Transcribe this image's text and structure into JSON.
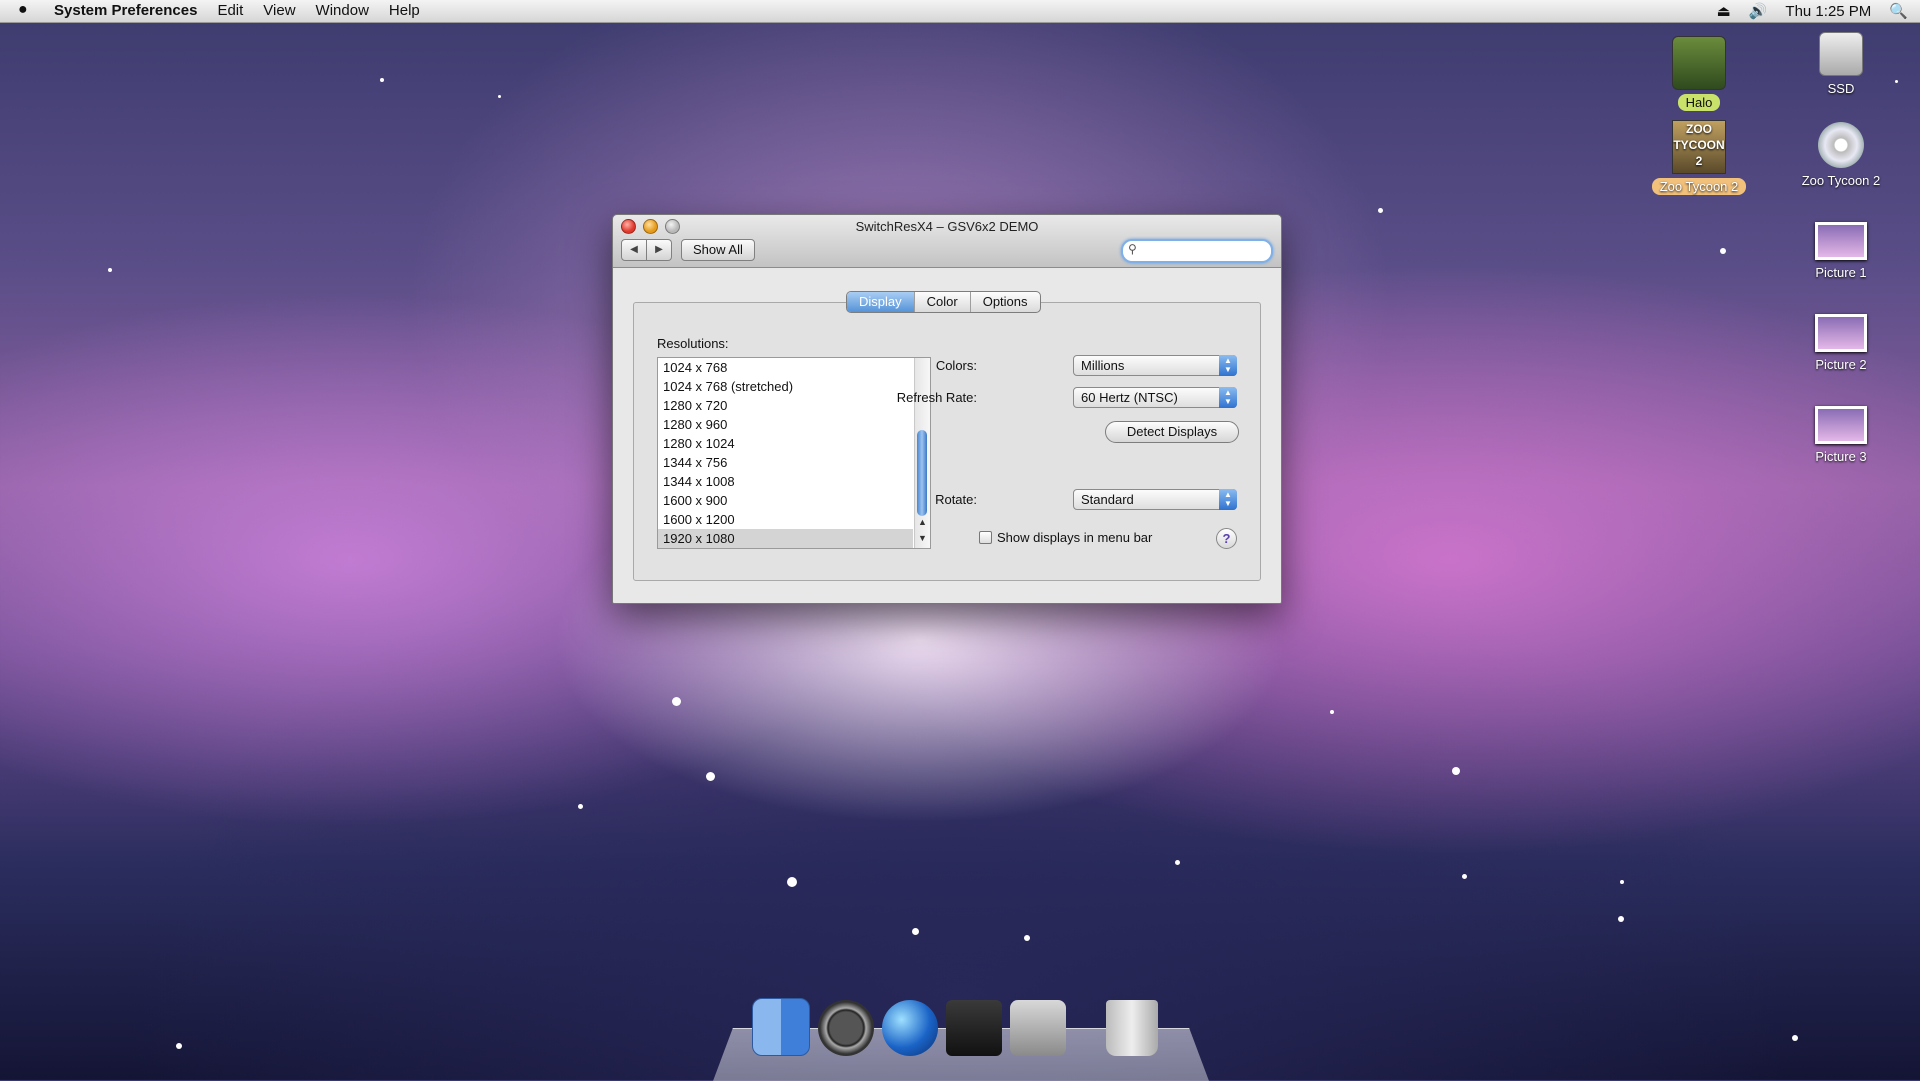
{
  "menubar": {
    "apple": "",
    "app_name": "System Preferences",
    "menus": [
      "Edit",
      "View",
      "Window",
      "Help"
    ],
    "clock": "Thu 1:25 PM"
  },
  "desktop": {
    "icons": [
      {
        "label": "Halo",
        "icon": "game-icon"
      },
      {
        "label": "SSD",
        "icon": "hard-drive-icon"
      },
      {
        "label": "Zoo Tycoon 2",
        "icon": "game-icon"
      },
      {
        "label": "Zoo Tycoon 2",
        "icon": "cd-icon"
      },
      {
        "label": "Picture 1",
        "icon": "picture-icon"
      },
      {
        "label": "Picture 2",
        "icon": "picture-icon"
      },
      {
        "label": "Picture 3",
        "icon": "picture-icon"
      }
    ],
    "zoo_box_text": "ZOO TYCOON 2"
  },
  "window": {
    "title": "SwitchResX4 – GSV6x2 DEMO",
    "show_all": "Show All",
    "search": {
      "value": "",
      "placeholder": ""
    },
    "tabs": [
      "Display",
      "Color",
      "Options"
    ],
    "active_tab": "Display",
    "resolutions_label": "Resolutions:",
    "resolutions": [
      "1024 x 768",
      "1024 x 768 (stretched)",
      "1280 x 720",
      "1280 x 960",
      "1280 x 1024",
      "1344 x 756",
      "1344 x 1008",
      "1600 x 900",
      "1600 x 1200",
      "1920 x 1080"
    ],
    "selected_resolution": "1920 x 1080",
    "colors_label": "Colors:",
    "colors_value": "Millions",
    "refresh_label": "Refresh Rate:",
    "refresh_value": "60 Hertz (NTSC)",
    "detect_button": "Detect Displays",
    "rotate_label": "Rotate:",
    "rotate_value": "Standard",
    "menu_bar_checkbox": "Show displays in menu bar",
    "menu_bar_checked": false,
    "help": "?"
  },
  "dock": {
    "items": [
      "finder-icon",
      "dashboard-icon",
      "globe-icon",
      "camera-icon",
      "system-preferences-icon",
      "trash-icon"
    ]
  }
}
